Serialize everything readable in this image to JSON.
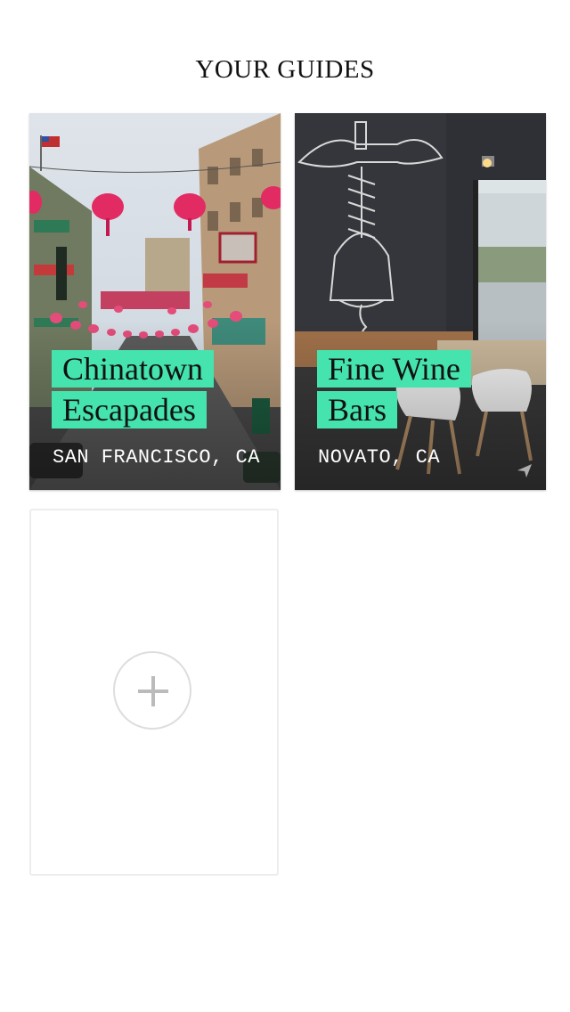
{
  "header": {
    "title": "YOUR GUIDES"
  },
  "guides": [
    {
      "title_line1": "Chinatown",
      "title_line2": "Escapades",
      "location": "SAN FRANCISCO, CA",
      "image": "chinatown-street-lanterns"
    },
    {
      "title_line1": "Fine Wine",
      "title_line2": "Bars",
      "location": "NOVATO, CA",
      "image": "wine-bar-corkscrew-mural"
    }
  ],
  "add_guide": {
    "icon": "plus-icon"
  },
  "colors": {
    "title_highlight": "#45e3ae",
    "add_border": "#dddddd",
    "plus": "#bbbbbb"
  }
}
